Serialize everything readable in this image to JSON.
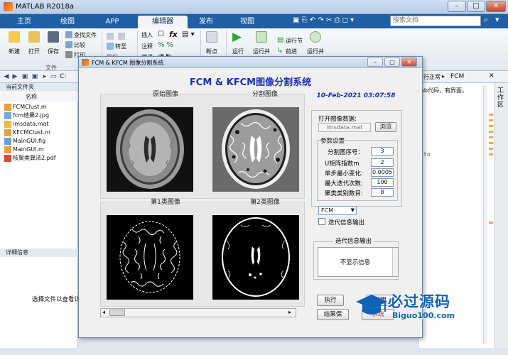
{
  "window": {
    "title": "MATLAB R2018a",
    "minimize": "–",
    "restore": "□",
    "close": "✕"
  },
  "tabs": [
    "主页",
    "绘图",
    "APP",
    "编辑器",
    "发布",
    "视图"
  ],
  "search": {
    "placeholder": "搜索文档"
  },
  "ribbon": {
    "new": "新建",
    "open": "打开",
    "save": "保存",
    "find_files": "查找文件",
    "compare": "比较",
    "print": "打印",
    "goto": "转至",
    "insert": "插入",
    "comment": "注释",
    "indent": "缩进",
    "breakpoints": "断点",
    "run": "运行",
    "run_advance": "运行并\n前进",
    "run_section": "运行节",
    "advance": "前进",
    "run_time": "运行并\n计时",
    "group_file": "文件",
    "group_nav": "导航"
  },
  "address": {
    "drive": "C:",
    "right_crumb": "运行正常",
    "right_file": "FCM"
  },
  "files_panel": {
    "header": "当前文件夹",
    "col_name": "名称",
    "files": [
      "FCMClust.m",
      "fcm结果2.jpg",
      "imsdata.mat",
      "KFCMClust.m",
      "MainGUI.fig",
      "MainGUI.m",
      "核聚类算法2.pdf"
    ]
  },
  "details_panel": {
    "header": "详细信息",
    "hint": "选择文件以查看详"
  },
  "editor_right": {
    "snippet1": "ab代码，有界面，",
    "snippet2": "to"
  },
  "side_tab": "工作区",
  "dialog": {
    "title": "FCM & KFCM 图像分割系统",
    "heading": "FCM & KFCM图像分割系统",
    "date": "10-Feb-2021 03:07:58",
    "captions": [
      "原始图像",
      "分割图像",
      "第1类图像",
      "第2类图像"
    ],
    "open_label": "打开图像数据:",
    "file_value": "imsdata.mat",
    "browse": "浏览",
    "params_title": "参数设置",
    "params": [
      {
        "label": "分割图序号：",
        "value": "3"
      },
      {
        "label": "U矩阵指数m",
        "value": "2"
      },
      {
        "label": "单步最小变化:",
        "value": "0.0005"
      },
      {
        "label": "最大迭代次数:",
        "value": "100"
      },
      {
        "label": "聚类类别数目:",
        "value": "8"
      }
    ],
    "method": "FCM",
    "iter_checkbox": "迭代信息输出",
    "iter_title": "迭代信息输出",
    "iter_text": "不显示信息",
    "exec_btn": "执行",
    "save_btn": "结果保",
    "help_btn": "说明"
  },
  "watermark": {
    "text": "必过源码",
    "url": "Biguo100.com"
  }
}
